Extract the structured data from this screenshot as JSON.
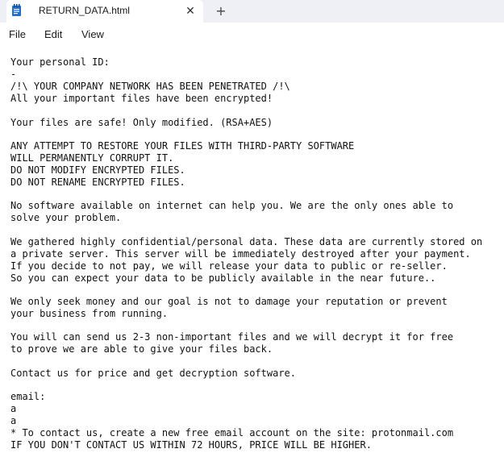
{
  "window": {
    "tab_title": "RETURN_DATA.html",
    "tab_close_glyph": "✕",
    "new_tab_glyph": "+"
  },
  "menu": {
    "file": "File",
    "edit": "Edit",
    "view": "View"
  },
  "document": {
    "lines": [
      "Your personal ID:",
      "-",
      "/!\\ YOUR COMPANY NETWORK HAS BEEN PENETRATED /!\\",
      "All your important files have been encrypted!",
      "Your files are safe! Only modified. (RSA+AES)",
      "ANY ATTEMPT TO RESTORE YOUR FILES WITH THIRD-PARTY SOFTWARE",
      "WILL PERMANENTLY CORRUPT IT.",
      "DO NOT MODIFY ENCRYPTED FILES.",
      "DO NOT RENAME ENCRYPTED FILES.",
      "No software available on internet can help you. We are the only ones able to",
      "solve your problem.",
      "We gathered highly confidential/personal data. These data are currently stored on",
      "a private server. This server will be immediately destroyed after your payment.",
      "If you decide to not pay, we will release your data to public or re-seller.",
      "So you can expect your data to be publicly available in the near future..",
      "We only seek money and our goal is not to damage your reputation or prevent",
      "your business from running.",
      "You will can send us 2-3 non-important files and we will decrypt it for free",
      "to prove we are able to give your files back.",
      "Contact us for price and get decryption software.",
      "email:",
      "a",
      "a",
      "* To contact us, create a new free email account on the site: protonmail.com",
      "IF YOU DON'T CONTACT US WITHIN 72 HOURS, PRICE WILL BE HIGHER."
    ]
  },
  "icons": {
    "tab_icon": "notepad-icon"
  },
  "colors": {
    "tab_bar_bg": "#eef0f5",
    "notepad_icon": "#1f6fd1"
  }
}
